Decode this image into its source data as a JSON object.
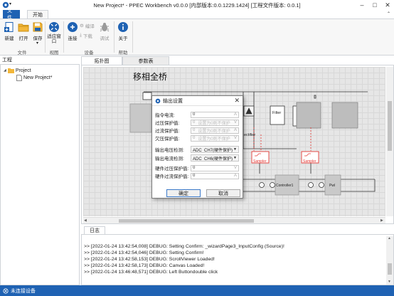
{
  "window": {
    "title": "New Project* - PPEC Workbench v0.0.0 [内部版本:0.0.1229.1424] [工程文件版本: 0.0.1]"
  },
  "ribbon": {
    "tabs": [
      {
        "label": "文件",
        "active": false
      },
      {
        "label": "开始",
        "active": true
      }
    ],
    "groups": [
      {
        "label": "文件",
        "buttons": [
          {
            "label": "新建",
            "icon": "new-file-icon"
          },
          {
            "label": "打开",
            "icon": "open-folder-icon"
          },
          {
            "label": "保存",
            "icon": "save-icon"
          }
        ]
      },
      {
        "label": "视图",
        "buttons": [
          {
            "label": "适应窗口",
            "icon": "fit-window-icon"
          }
        ]
      },
      {
        "label": "设备",
        "buttons": [
          {
            "label": "连接",
            "icon": "connect-icon"
          },
          {
            "label": "编译",
            "icon": "compile-icon"
          },
          {
            "label": "下载",
            "icon": "download-icon"
          },
          {
            "label": "调试",
            "icon": "debug-icon"
          }
        ]
      },
      {
        "label": "帮助",
        "buttons": [
          {
            "label": "关于",
            "icon": "about-icon"
          }
        ]
      }
    ]
  },
  "project": {
    "header": "工程",
    "root": "Project",
    "child": "New Project*"
  },
  "doc_tabs": [
    {
      "label": "拓扑图",
      "active": true
    },
    {
      "label": "参数表",
      "active": false
    }
  ],
  "canvas": {
    "title": "移相全桥",
    "labels": {
      "filter": "Filter",
      "controller": "Controller1",
      "pwm": "Pwl",
      "sampler1": "Sampler",
      "sampler2": "Sampler",
      "rectifier": "ectifier"
    }
  },
  "dialog": {
    "title": "输出设置",
    "fields": [
      {
        "label": "指令电流:",
        "value": "0",
        "placeholder": "",
        "unit": "A",
        "enabled": true
      },
      {
        "label": "过压保护值:",
        "value": "0",
        "placeholder": "设置为0则不保护",
        "unit": "V",
        "enabled": false
      },
      {
        "label": "过流保护值:",
        "value": "0",
        "placeholder": "设置为0则不保护",
        "unit": "A",
        "enabled": false
      },
      {
        "label": "欠压保护值:",
        "value": "0",
        "placeholder": "设置为0则不保护",
        "unit": "V",
        "enabled": false
      }
    ],
    "selects": [
      {
        "label": "输出电压检测:",
        "value": "ADC_CH7(硬件保护)"
      },
      {
        "label": "输出电流检测:",
        "value": "ADC_CH6(硬件保护)"
      }
    ],
    "hw_fields": [
      {
        "label": "硬件过压保护值:",
        "value": "0",
        "unit": "V"
      },
      {
        "label": "硬件过流保护值:",
        "value": "0",
        "unit": "A"
      }
    ],
    "ok_label": "确定",
    "cancel_label": "取消"
  },
  "log": {
    "tab_label": "日志",
    "lines": [
      ">> [2022-01-24 13:42:54,008] DEBUG: Setting Confirm: _wizardPage3_InputConfig (Source)!",
      ">> [2022-01-24 13:42:54,046] DEBUG: Setting Confirm!",
      ">> [2022-01-24 13:42:58,153] DEBUG: ScrollViewer Loaded!",
      ">> [2022-01-24 13:42:58,173] DEBUG: Canvas Loaded!",
      ">> [2022-01-24 13:46:48,571] DEBUG: Left Buttondouble click"
    ]
  },
  "status": {
    "text": "未连接设备"
  },
  "colors": {
    "accent": "#1f62b3",
    "sampler": "#e53935"
  }
}
